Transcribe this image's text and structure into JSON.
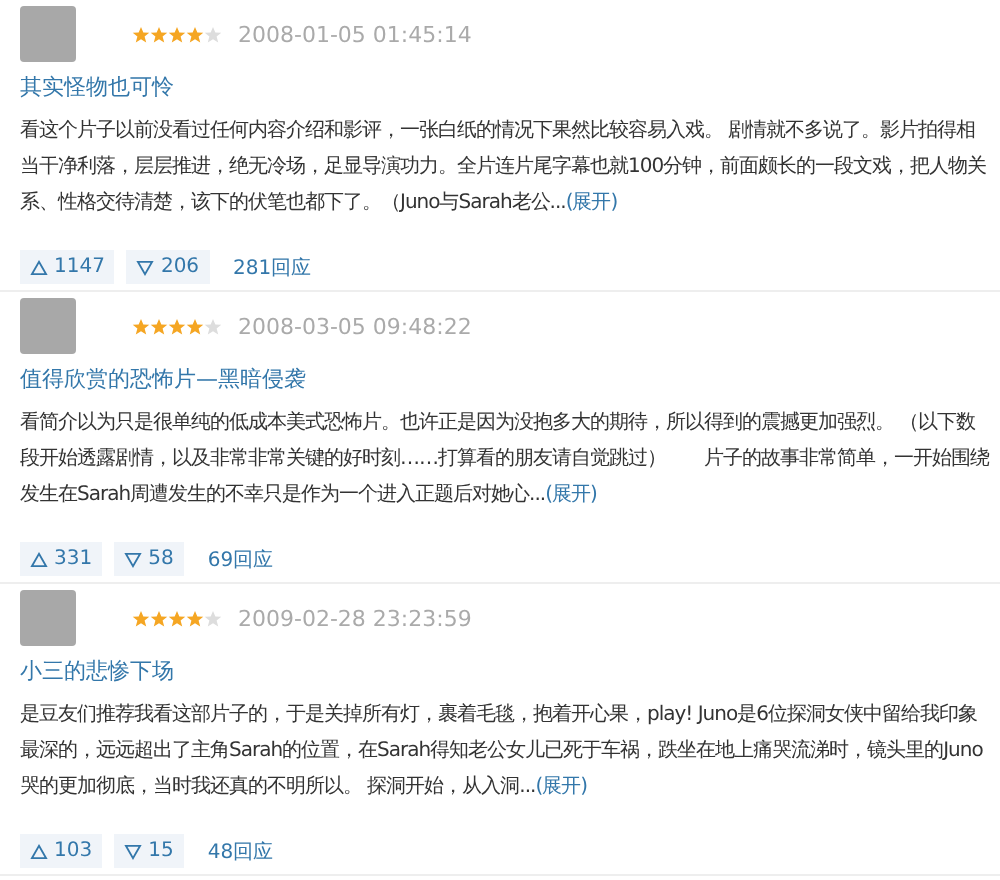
{
  "reviews": [
    {
      "stars": 4,
      "date": "2008-01-05 01:45:14",
      "title": "其实怪物也可怜",
      "body": "看这个片子以前没看过任何内容介绍和影评，一张白纸的情况下果然比较容易入戏。 剧情就不多说了。影片拍得相当干净利落，层层推进，绝无冷场，足显导演功力。全片连片尾字幕也就100分钟，前面颇长的一段文戏，把人物关系、性格交待清楚，该下的伏笔也都下了。（Juno与Sarah老公...",
      "expand": "(展开)",
      "up": "1147",
      "down": "206",
      "replies": "281回应"
    },
    {
      "stars": 4,
      "date": "2008-03-05 09:48:22",
      "title": "值得欣赏的恐怖片—黑暗侵袭",
      "body": "看简介以为只是很单纯的低成本美式恐怖片。也许正是因为没抱多大的期待，所以得到的震撼更加强烈。 （以下数段开始透露剧情，以及非常非常关键的好时刻……打算看的朋友请自觉跳过）　　片子的故事非常简单，一开始围绕发生在Sarah周遭发生的不幸只是作为一个进入正题后对她心...",
      "expand": "(展开)",
      "up": "331",
      "down": "58",
      "replies": "69回应"
    },
    {
      "stars": 4,
      "date": "2009-02-28 23:23:59",
      "title": "小三的悲惨下场",
      "body": "是豆友们推荐我看这部片子的，于是关掉所有灯，裹着毛毯，抱着开心果，play! Juno是6位探洞女侠中留给我印象最深的，远远超出了主角Sarah的位置，在Sarah得知老公女儿已死于车祸，跌坐在地上痛哭流涕时，镜头里的Juno哭的更加彻底，当时我还真的不明所以。 探洞开始，从入洞...",
      "expand": "(展开)",
      "up": "103",
      "down": "15",
      "replies": "48回应"
    }
  ]
}
